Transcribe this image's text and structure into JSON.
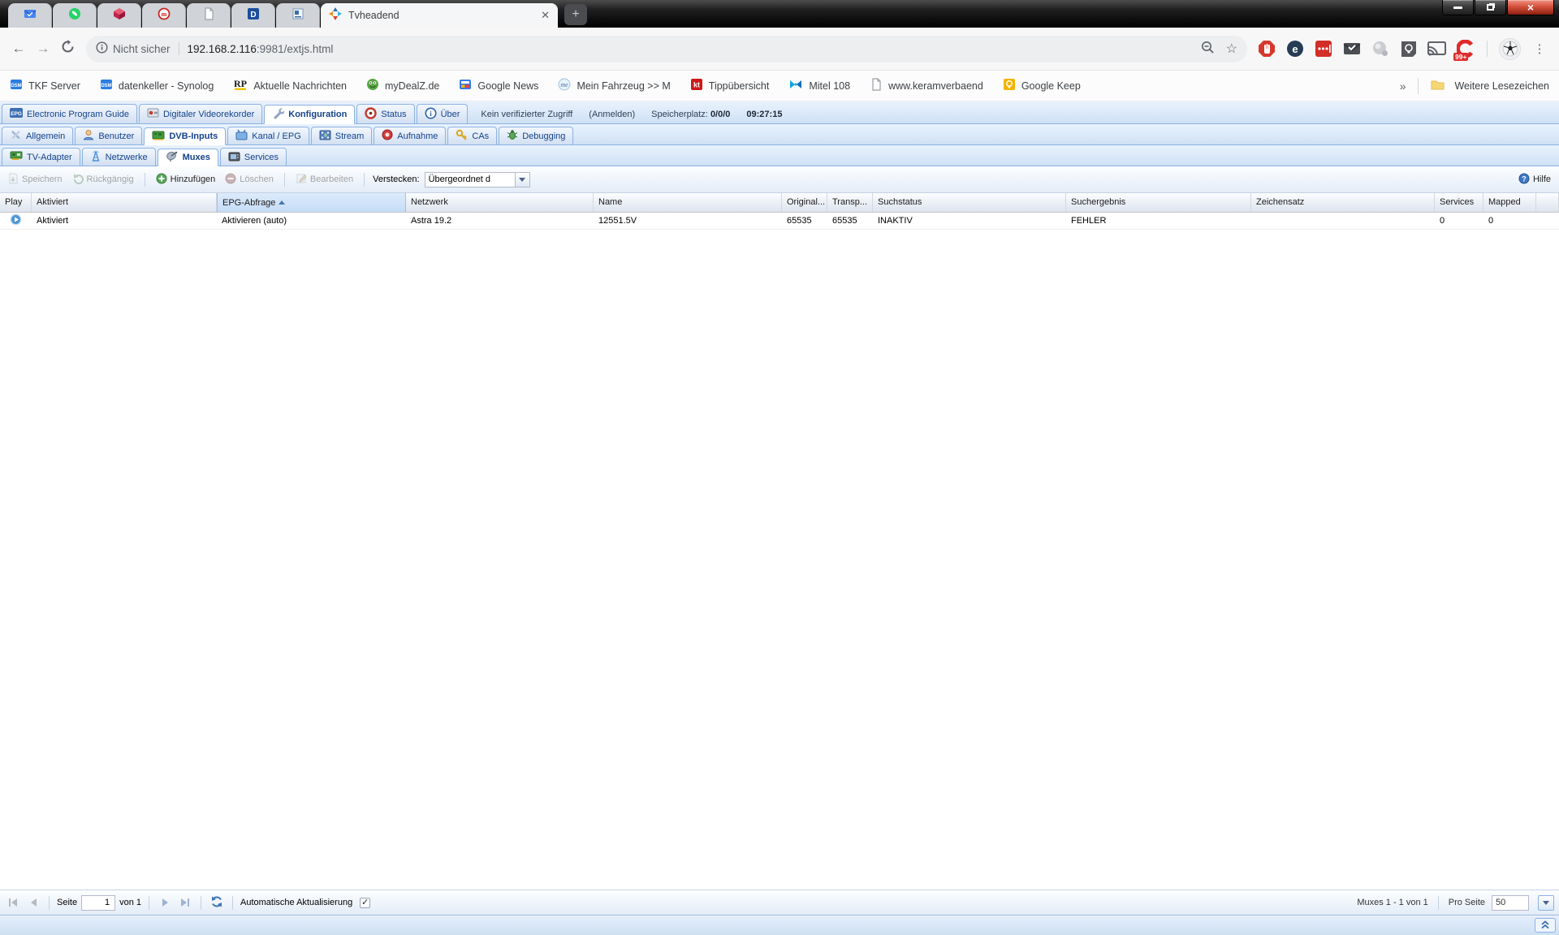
{
  "colors": {
    "ext_border": "#8db2e3",
    "ext_text": "#15428b",
    "close_button_red": "#d4513c",
    "badge_red": "#e02a2a"
  },
  "browser": {
    "tab_title": "Tvheadend",
    "security_text": "Nicht sicher",
    "url_host": "192.168.2.116",
    "url_path": ":9981/extjs.html",
    "extension_badge": "99+",
    "bookmarks": [
      {
        "label": "TKF Server"
      },
      {
        "label": "datenkeller - Synolog"
      },
      {
        "label": "Aktuelle Nachrichten"
      },
      {
        "label": "myDealZ.de"
      },
      {
        "label": "Google News"
      },
      {
        "label": "Mein Fahrzeug >> M"
      },
      {
        "label": "Tippübersicht"
      },
      {
        "label": "Mitel 108"
      },
      {
        "label": "www.keramverbaend"
      },
      {
        "label": "Google Keep"
      }
    ],
    "bookmarks_overflow": "»",
    "other_bookmarks": "Weitere Lesezeichen"
  },
  "app": {
    "main_tabs": [
      {
        "label": "Electronic Program Guide"
      },
      {
        "label": "Digitaler Videorekorder"
      },
      {
        "label": "Konfiguration"
      },
      {
        "label": "Status"
      },
      {
        "label": "Über"
      }
    ],
    "session": {
      "access": "Kein verifizierter Zugriff",
      "login": "(Anmelden)",
      "storage_label": "Speicherplatz:",
      "storage_value": "0/0/0",
      "time": "09:27:15"
    },
    "config_tabs": [
      {
        "label": "Allgemein"
      },
      {
        "label": "Benutzer"
      },
      {
        "label": "DVB-Inputs"
      },
      {
        "label": "Kanal / EPG"
      },
      {
        "label": "Stream"
      },
      {
        "label": "Aufnahme"
      },
      {
        "label": "CAs"
      },
      {
        "label": "Debugging"
      }
    ],
    "dvb_tabs": [
      {
        "label": "TV-Adapter"
      },
      {
        "label": "Netzwerke"
      },
      {
        "label": "Muxes"
      },
      {
        "label": "Services"
      }
    ],
    "toolbar": {
      "save": "Speichern",
      "undo": "Rückgängig",
      "add": "Hinzufügen",
      "delete": "Löschen",
      "edit": "Bearbeiten",
      "hide_label": "Verstecken:",
      "hide_value": "Übergeordnet d",
      "help": "Hilfe"
    },
    "grid": {
      "columns": [
        {
          "label": "Play"
        },
        {
          "label": "Aktiviert"
        },
        {
          "label": "EPG-Abfrage",
          "sorted": "asc"
        },
        {
          "label": "Netzwerk"
        },
        {
          "label": "Name"
        },
        {
          "label": "Original..."
        },
        {
          "label": "Transp..."
        },
        {
          "label": "Suchstatus"
        },
        {
          "label": "Suchergebnis"
        },
        {
          "label": "Zeichensatz"
        },
        {
          "label": "Services"
        },
        {
          "label": "Mapped"
        }
      ],
      "row": {
        "aktiviert": "Aktiviert",
        "epg_abfrage": "Aktivieren (auto)",
        "netzwerk": "Astra 19.2",
        "name": "12551.5V",
        "original": "65535",
        "transport": "65535",
        "suchstatus": "INAKTIV",
        "suchergebnis": "FEHLER",
        "zeichensatz": "",
        "services": "0",
        "mapped": "0"
      }
    },
    "paging": {
      "seite_label": "Seite",
      "page_value": "1",
      "von_label": "von 1",
      "auto_refresh_label": "Automatische Aktualisierung",
      "range_text": "Muxes 1 - 1 von 1",
      "per_page_label": "Pro Seite",
      "per_page_value": "50"
    }
  }
}
